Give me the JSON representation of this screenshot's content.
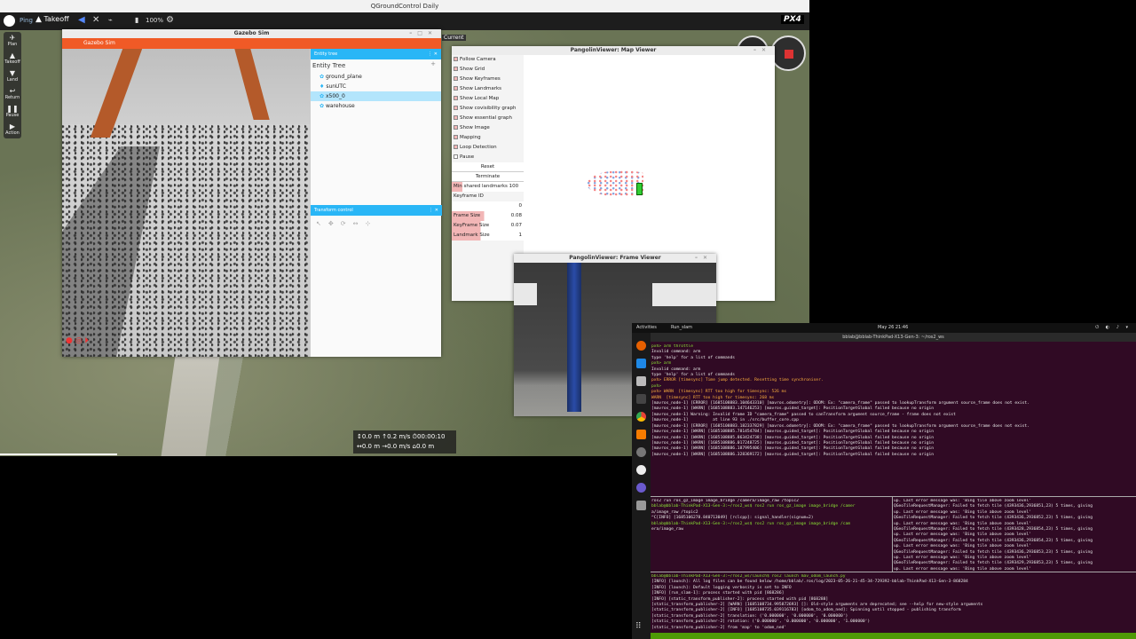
{
  "qgc": {
    "window_title": "QGroundControl Daily",
    "toolbar": {
      "status": "Ping",
      "takeoff": "Takeoff",
      "battery": "100%",
      "logo": "PX4"
    },
    "fly_tools": [
      "Plan",
      "Takeoff",
      "Land",
      "Return",
      "Pause",
      "Action"
    ],
    "partial_label": "Current",
    "telemetry": {
      "row1": "↕0.0 m  ↑0.2 m/s  ⏱00:00:10",
      "row2": "↔0.0 m  →0.0 m/s  ⌂0.0 m"
    }
  },
  "gazebo": {
    "window_title": "Gazebo Sim",
    "app_bar": "Gazebo Sim",
    "entity_tree_header": "Entity tree",
    "entity_tree_title": "Entity Tree",
    "entities": [
      "ground_plane",
      "sunUTC",
      "x500_0",
      "warehouse"
    ],
    "selected_entity": "x500_0",
    "transform_header": "Transform control"
  },
  "map_viewer": {
    "title": "PangolinViewer: Map Viewer",
    "checkboxes": [
      "Follow Camera",
      "Show Grid",
      "Show Keyframes",
      "Show Landmarks",
      "Show Local Map",
      "Show covisibility graph",
      "Show essential graph",
      "Show Image",
      "Mapping",
      "Loop Detection",
      "Pause"
    ],
    "buttons": [
      "Reset",
      "Terminate"
    ],
    "min_shared": "Min shared landmarks 100",
    "keyframe_id_label": "Keyframe ID",
    "keyframe_id_value": "0",
    "frame_size_label": "Frame Size",
    "frame_size_value": "0.08",
    "keyframe_size_label": "KeyFrame Size",
    "keyframe_size_value": "0.07",
    "landmark_size_label": "Landmark Size",
    "landmark_size_value": "1"
  },
  "frame_viewer": {
    "title": "PangolinViewer: Frame Viewer"
  },
  "desktop": {
    "activities": "Activities",
    "app_name": "Run_slam",
    "clock": "May 26  21:46",
    "terminal_title": "bblab@bblab-ThinkPad-X13-Gen-3: ~/ros2_ws"
  },
  "terminal": {
    "pane_top": [
      "pxh> arm throttle",
      "Invalid command: arm",
      "type 'help' for a list of commands",
      "pxh> arm",
      "Invalid command: arm",
      "type 'help' for a list of commands",
      "pxh> ERROR [timesync] Time jump detected. Resetting time synchroniser.",
      "",
      "pxh>",
      "pxh> WARN  [timesync] RTT too high for timesync: 526 ms",
      "WARN  [timesync] RTT too high for timesync: 268 ms",
      "",
      "[mavros_node-1] [ERROR] [1685108883.104643310] [mavros.odometry]: ODOM: Ex: \"camera_frame\" passed to lookupTransform argument source_frame does not exist.",
      "[mavros_node-1] [WARN] [1685108883.147146253] [mavros.guided_target]: PositionTargetGlobal failed because no origin",
      "[mavros_node-1] Warning: Invalid frame ID \"camera_frame\" passed to canTransform argument source_frame - frame does not exist",
      "[mavros_node-1]          at line 93 in ./src/buffer_core.cpp",
      "[mavros_node-1] [ERROR] [1685108883.182337829] [mavros.odometry]: ODOM: Ex: \"camera_frame\" passed to lookupTransform argument source_frame does not exist.",
      "[mavros_node-1] [WARN] [1685108885.781454784] [mavros.guided_target]: PositionTargetGlobal failed because no origin",
      "[mavros_node-1] [WARN] [1685108885.863424738] [mavros.guided_target]: PositionTargetGlobal failed because no origin",
      "[mavros_node-1] [WARN] [1685108886.017248725] [mavros.guided_target]: PositionTargetGlobal failed because no origin",
      "[mavros_node-1] [WARN] [1685108886.187995406] [mavros.guided_target]: PositionTargetGlobal failed because no origin",
      "[mavros_node-1] [WARN] [1685108886.328369172] [mavros.guided_target]: PositionTargetGlobal failed because no origin"
    ],
    "pane_left": [
      "ros2 run ros_gz_image image_bridge /camera/image_raw /topic2",
      "bblab@bblab-ThinkPad-X13-Gen-3:~/ros2_ws$ ros2 run ros_gz_image image_bridge /camer",
      "a/image_raw /topic2",
      "^C[INFO] [1685106278.840713049] [rclcpp]: signal_handler(signum=2)",
      "bblab@bblab-ThinkPad-X13-Gen-3:~/ros2_ws$ ros2 run ros_gz_image image_bridge /cam",
      "era/image_raw"
    ],
    "pane_right": [
      "up. Last error message was: 'Bing tile above zoom level'",
      "QGeoTileRequestManager: Failed to fetch tile (4393436,2936851,23) 5 times, giving",
      "up. Last error message was: 'Bing tile above zoom level'",
      "QGeoTileRequestManager: Failed to fetch tile (4393436,2936852,23) 5 times, giving",
      "up. Last error message was: 'Bing tile above zoom level'",
      "QGeoTileRequestManager: Failed to fetch tile (4393428,2936854,23) 5 times, giving",
      "up. Last error message was: 'Bing tile above zoom level'",
      "QGeoTileRequestManager: Failed to fetch tile (4393436,2936854,23) 5 times, giving",
      "up. Last error message was: 'Bing tile above zoom level'",
      "QGeoTileRequestManager: Failed to fetch tile (4393436,2936853,23) 5 times, giving",
      "up. Last error message was: 'Bing tile above zoom level'",
      "QGeoTileRequestManager: Failed to fetch tile (4393429,2936853,23) 5 times, giving",
      "up. Last error message was: 'Bing tile above zoom level'"
    ],
    "pane_bottom": [
      "bblab@bblab-ThinkPad-X13-Gen-3:~/ros2_ws/launch$ ros2 launch mav_odom_launch.py",
      "[INFO] [launch]: All log files can be found below /home/bblab/.ros/log/2023-05-26-21-45-34-729392-bblab-ThinkPad-X13-Gen-3-868284",
      "[INFO] [launch]: Default logging verbosity is set to INFO",
      "[INFO] [run_slam-1]: process started with pid [868286]",
      "[INFO] [static_transform_publisher-2]: process started with pid [868288]",
      "[static_transform_publisher-2] [WARN] [1685108734.995872693] []: Old-style arguments are deprecated; see --help for new-style arguments",
      "[static_transform_publisher-2] [INFO] [1685108735.039116783] [odom_to_odom_ned]: Spinning until stopped - publishing transform",
      "[static_transform_publisher-2] translation: ('0.000000', '0.000000', '0.000000')",
      "[static_transform_publisher-2] rotation: ('0.000000', '0.000000', '0.000000', '1.000000')",
      "[static_transform_publisher-2] from 'map' to 'odom_ned'"
    ]
  }
}
